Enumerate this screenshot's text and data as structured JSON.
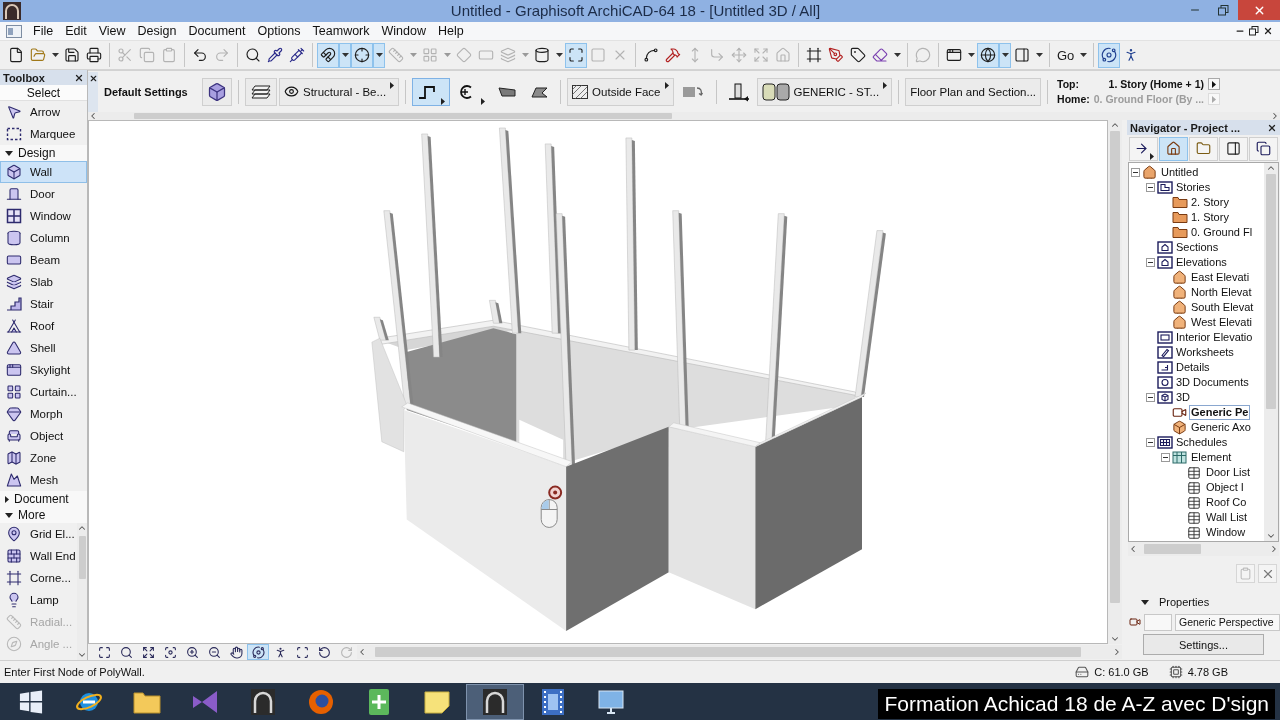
{
  "window": {
    "title": "Untitled - Graphisoft ArchiCAD-64 18 - [Untitled 3D / All]"
  },
  "menu_bar": {
    "items": [
      "File",
      "Edit",
      "View",
      "Design",
      "Document",
      "Options",
      "Teamwork",
      "Window",
      "Help"
    ]
  },
  "toolbar": {
    "groups": [
      [
        {
          "selected": false,
          "disabled": false,
          "menu": false
        },
        {
          "selected": false,
          "disabled": false,
          "menu": true
        },
        {
          "selected": false,
          "disabled": false,
          "menu": false
        },
        {
          "selected": false,
          "disabled": false,
          "menu": false
        }
      ],
      [
        {
          "selected": false,
          "disabled": true,
          "menu": false
        },
        {
          "selected": false,
          "disabled": true,
          "menu": false
        },
        {
          "selected": false,
          "disabled": true,
          "menu": false
        }
      ],
      [
        {
          "selected": false,
          "disabled": false,
          "menu": false
        },
        {
          "selected": false,
          "disabled": true,
          "menu": false
        }
      ],
      [
        {
          "selected": false,
          "disabled": false,
          "menu": false
        },
        {
          "selected": false,
          "disabled": false,
          "menu": false
        },
        {
          "selected": false,
          "disabled": false,
          "menu": false
        }
      ],
      [
        {
          "selected": true,
          "disabled": false,
          "menu": true
        },
        {
          "selected": true,
          "disabled": false,
          "menu": true
        },
        {
          "selected": false,
          "disabled": true,
          "menu": true
        },
        {
          "selected": false,
          "disabled": true,
          "menu": true
        },
        {
          "selected": false,
          "disabled": true,
          "menu": false
        },
        {
          "selected": false,
          "disabled": true,
          "menu": false
        },
        {
          "selected": false,
          "disabled": true,
          "menu": true
        },
        {
          "selected": false,
          "disabled": false,
          "menu": true
        },
        {
          "selected": true,
          "disabled": false,
          "menu": false
        },
        {
          "selected": false,
          "disabled": true,
          "menu": false
        },
        {
          "selected": false,
          "disabled": true,
          "menu": false
        }
      ],
      [
        {
          "selected": false,
          "disabled": false,
          "menu": false
        },
        {
          "selected": false,
          "disabled": false,
          "menu": false
        },
        {
          "selected": false,
          "disabled": true,
          "menu": false
        },
        {
          "selected": false,
          "disabled": true,
          "menu": false
        },
        {
          "selected": false,
          "disabled": true,
          "menu": false
        },
        {
          "selected": false,
          "disabled": true,
          "menu": false
        },
        {
          "selected": false,
          "disabled": true,
          "menu": false
        }
      ],
      [
        {
          "selected": false,
          "disabled": false,
          "menu": false
        },
        {
          "selected": false,
          "disabled": false,
          "menu": false
        },
        {
          "selected": false,
          "disabled": false,
          "menu": false
        },
        {
          "selected": false,
          "disabled": false,
          "menu": true
        }
      ],
      [
        {
          "selected": false,
          "disabled": true,
          "menu": false
        }
      ],
      [
        {
          "selected": false,
          "disabled": false,
          "menu": true
        },
        {
          "selected": true,
          "disabled": false,
          "menu": true
        },
        {
          "selected": false,
          "disabled": false,
          "menu": true
        }
      ],
      [
        {
          "label": "Go",
          "selected": false,
          "disabled": false,
          "menu": true
        }
      ],
      [
        {
          "selected": true,
          "disabled": false,
          "menu": false
        },
        {
          "selected": false,
          "disabled": false,
          "menu": false
        }
      ]
    ]
  },
  "toolbox": {
    "title": "Toolbox",
    "sections": [
      {
        "kind": "header",
        "label": "Select",
        "items": [
          {
            "label": "Arrow",
            "selected": false,
            "disabled": false
          },
          {
            "label": "Marquee",
            "selected": false,
            "disabled": false
          }
        ]
      },
      {
        "kind": "group",
        "label": "Design",
        "expanded": true,
        "items": [
          {
            "label": "Wall",
            "selected": true,
            "disabled": false
          },
          {
            "label": "Door",
            "selected": false,
            "disabled": false
          },
          {
            "label": "Window",
            "selected": false,
            "disabled": false
          },
          {
            "label": "Column",
            "selected": false,
            "disabled": false
          },
          {
            "label": "Beam",
            "selected": false,
            "disabled": false
          },
          {
            "label": "Slab",
            "selected": false,
            "disabled": false
          },
          {
            "label": "Stair",
            "selected": false,
            "disabled": false
          },
          {
            "label": "Roof",
            "selected": false,
            "disabled": false
          },
          {
            "label": "Shell",
            "selected": false,
            "disabled": false
          },
          {
            "label": "Skylight",
            "selected": false,
            "disabled": false
          },
          {
            "label": "Curtain...",
            "selected": false,
            "disabled": false
          },
          {
            "label": "Morph",
            "selected": false,
            "disabled": false
          },
          {
            "label": "Object",
            "selected": false,
            "disabled": false
          },
          {
            "label": "Zone",
            "selected": false,
            "disabled": false
          },
          {
            "label": "Mesh",
            "selected": false,
            "disabled": false
          }
        ]
      },
      {
        "kind": "group",
        "label": "Document",
        "expanded": false
      },
      {
        "kind": "group",
        "label": "More",
        "expanded": true,
        "items": [
          {
            "label": "Grid El...",
            "selected": false,
            "disabled": false
          },
          {
            "label": "Wall End",
            "selected": false,
            "disabled": false
          },
          {
            "label": "Corne...",
            "selected": false,
            "disabled": false
          },
          {
            "label": "Lamp",
            "selected": false,
            "disabled": false
          },
          {
            "label": "Radial...",
            "selected": false,
            "disabled": true
          },
          {
            "label": "Angle ...",
            "selected": false,
            "disabled": true
          }
        ]
      }
    ]
  },
  "info_box": {
    "title": "Default Settings",
    "layer": "Structural - Be...",
    "geometry_methods": [
      {
        "selected": true,
        "menu": true
      },
      {
        "selected": false,
        "menu": true
      },
      {
        "selected": false,
        "menu": false
      },
      {
        "selected": false,
        "menu": false
      }
    ],
    "reference_line": "Outside Face",
    "composite": "GENERIC - ST...",
    "view_button": "Floor Plan and Section...",
    "story_range": [
      {
        "label": "Top:",
        "value": "1. Story (Home + 1)",
        "disabled": false
      },
      {
        "label": "Home:",
        "value": "0. Ground Floor (By ...",
        "disabled": true
      }
    ]
  },
  "view_controls": [
    {
      "selected": false,
      "disabled": false
    },
    {
      "selected": false,
      "disabled": false
    },
    {
      "selected": false,
      "disabled": false
    },
    {
      "selected": false,
      "disabled": false
    },
    {
      "selected": false,
      "disabled": false
    },
    {
      "selected": false,
      "disabled": false
    },
    {
      "selected": false,
      "disabled": false
    },
    {
      "selected": true,
      "disabled": false
    },
    {
      "selected": false,
      "disabled": false
    },
    {
      "selected": false,
      "disabled": false
    },
    {
      "selected": false,
      "disabled": false
    },
    {
      "selected": false,
      "disabled": true
    }
  ],
  "navigator": {
    "title": "Navigator - Project ...",
    "tabs": [
      {
        "selected": false,
        "menu": true
      },
      {
        "selected": true,
        "menu": false
      },
      {
        "selected": false,
        "menu": false
      },
      {
        "selected": false,
        "menu": false
      },
      {
        "selected": false,
        "menu": false
      }
    ],
    "tree": [
      {
        "label": "Untitled",
        "kind": "project",
        "expanded": true,
        "selected": false,
        "children": [
          {
            "label": "Stories",
            "kind": "plan",
            "expanded": true,
            "selected": false,
            "children": [
              {
                "label": "2. Story",
                "kind": "story",
                "selected": false
              },
              {
                "label": "1. Story",
                "kind": "story",
                "selected": false
              },
              {
                "label": "0. Ground Fl",
                "kind": "story",
                "selected": false
              }
            ]
          },
          {
            "label": "Sections",
            "kind": "section",
            "selected": false
          },
          {
            "label": "Elevations",
            "kind": "section",
            "expanded": true,
            "selected": false,
            "children": [
              {
                "label": "East Elevati",
                "kind": "elevation",
                "selected": false
              },
              {
                "label": "North Elevat",
                "kind": "elevation",
                "selected": false
              },
              {
                "label": "South Elevat",
                "kind": "elevation",
                "selected": false
              },
              {
                "label": "West Elevati",
                "kind": "elevation",
                "selected": false
              }
            ]
          },
          {
            "label": "Interior Elevatio",
            "kind": "interior",
            "selected": false
          },
          {
            "label": "Worksheets",
            "kind": "worksheet",
            "selected": false
          },
          {
            "label": "Details",
            "kind": "detail",
            "selected": false
          },
          {
            "label": "3D Documents",
            "kind": "document3d",
            "selected": false
          },
          {
            "label": "3D",
            "kind": "view3d",
            "expanded": true,
            "selected": false,
            "children": [
              {
                "label": "Generic Pe",
                "kind": "camera",
                "selected": true
              },
              {
                "label": "Generic Axo",
                "kind": "axon",
                "selected": false
              }
            ]
          },
          {
            "label": "Schedules",
            "kind": "schedules",
            "expanded": true,
            "selected": false,
            "children": [
              {
                "label": "Element",
                "kind": "element",
                "expanded": true,
                "selected": false,
                "children": [
                  {
                    "label": "Door List",
                    "kind": "schedule",
                    "selected": false
                  },
                  {
                    "label": "Object I",
                    "kind": "schedule",
                    "selected": false
                  },
                  {
                    "label": "Roof Co",
                    "kind": "schedule",
                    "selected": false
                  },
                  {
                    "label": "Wall List",
                    "kind": "schedule",
                    "selected": false
                  },
                  {
                    "label": "Window",
                    "kind": "schedule",
                    "selected": false
                  }
                ]
              }
            ]
          }
        ]
      }
    ],
    "actions": [
      {
        "disabled": true
      },
      {
        "disabled": false
      }
    ],
    "properties": {
      "title": "Properties",
      "expanded": true,
      "name": "Generic Perspective",
      "button": "Settings..."
    }
  },
  "status_bar": {
    "message": "Enter First Node of PolyWall.",
    "disk": "C: 61.0 GB",
    "memory": "4.78 GB"
  },
  "taskbar": {
    "items": [
      {
        "selected": false
      },
      {
        "selected": false
      },
      {
        "selected": false
      },
      {
        "selected": false
      },
      {
        "selected": false
      },
      {
        "selected": false
      },
      {
        "selected": false
      },
      {
        "selected": false
      },
      {
        "selected": true
      },
      {
        "selected": false
      },
      {
        "selected": false
      }
    ]
  },
  "video_caption": "Formation Achicad 18 de A-Z avec D'sign"
}
